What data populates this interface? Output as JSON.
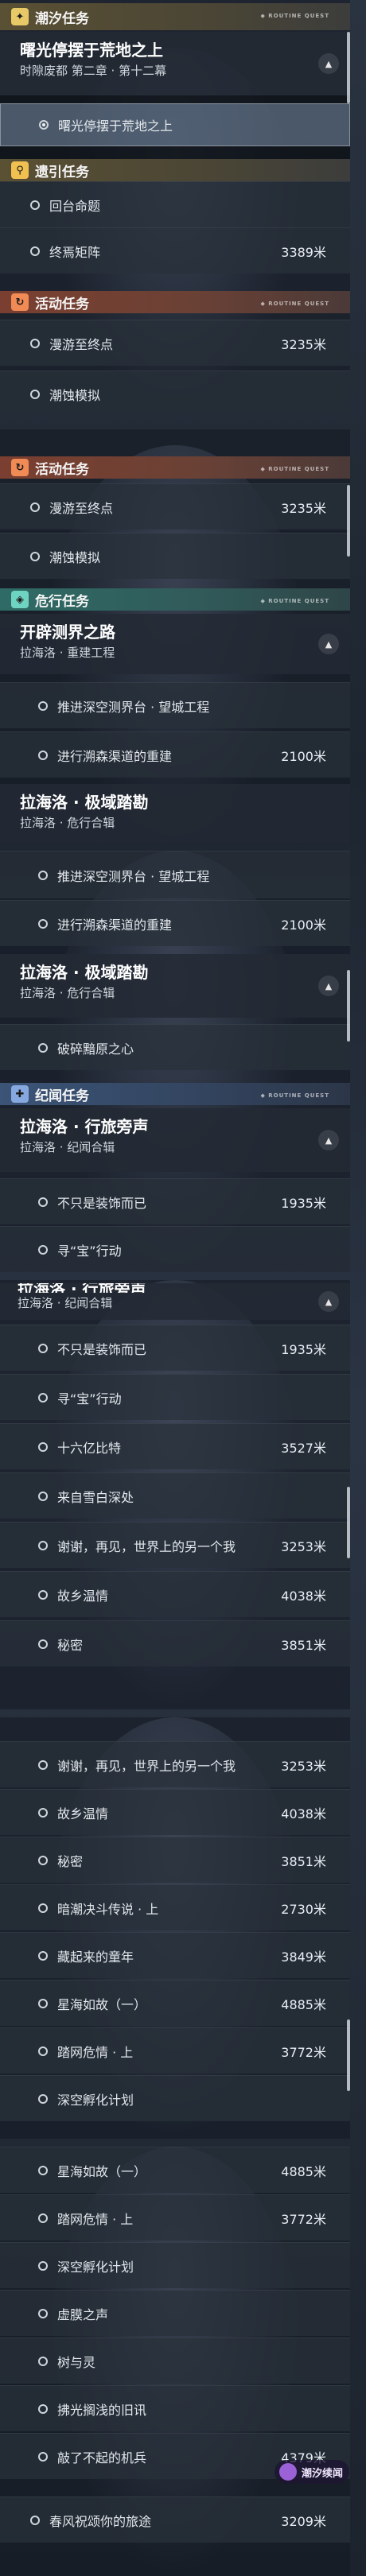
{
  "screen1": {
    "cat_chaoxi": {
      "label": "潮汐任务",
      "icon": "star-icon"
    },
    "main_quest": {
      "name": "曙光停摆于荒地之上",
      "sub": "时隙废都 第二章 · 第十二幕",
      "task": "曙光停摆于荒地之上"
    },
    "cat_guide": {
      "label": "遗引任务",
      "icon": "pin-icon"
    },
    "guide_tasks": [
      {
        "label": "回台命题",
        "dist": ""
      },
      {
        "label": "终焉矩阵",
        "dist": "3389米"
      }
    ],
    "cat_activity": {
      "label": "活动任务",
      "icon": "refresh-icon"
    },
    "activity_tasks": [
      {
        "label": "漫游至终点",
        "dist": "3235米"
      },
      {
        "label": "潮蚀模拟",
        "dist": ""
      }
    ]
  },
  "screen2": {
    "cat_activity": {
      "label": "活动任务"
    },
    "activity_tasks": [
      {
        "label": "漫游至终点",
        "dist": "3235米"
      },
      {
        "label": "潮蚀模拟",
        "dist": ""
      }
    ],
    "cat_danger": {
      "label": "危行任务",
      "icon": "diamond-icon"
    },
    "quest1": {
      "name": "开辟测界之路",
      "sub": "拉海洛 · 重建工程"
    },
    "quest1_tasks": [
      {
        "label": "推进深空测界台 · 望城工程",
        "dist": ""
      },
      {
        "label": "进行溯森渠道的重建",
        "dist": "2100米"
      }
    ],
    "quest2": {
      "name": "拉海洛 · 极域踏勘",
      "sub": "拉海洛 · 危行合辑"
    }
  },
  "screen3": {
    "tasks": [
      {
        "label": "推进深空测界台 · 望城工程",
        "dist": ""
      },
      {
        "label": "进行溯森渠道的重建",
        "dist": "2100米"
      }
    ],
    "quest2": {
      "name": "拉海洛 · 极域踏勘",
      "sub": "拉海洛 · 危行合辑"
    },
    "quest2_task": {
      "label": "破碎黯原之心",
      "dist": ""
    },
    "cat_chronicle": {
      "label": "纪闻任务",
      "icon": "plus-icon"
    },
    "quest3": {
      "name": "拉海洛 · 行旅旁声",
      "sub": "拉海洛 · 纪闻合辑"
    },
    "quest3_tasks": [
      {
        "label": "不只是装饰而已",
        "dist": "1935米"
      },
      {
        "label": "寻“宝”行动",
        "dist": ""
      }
    ]
  },
  "screen4": {
    "partial_title": "拉海洛 · 行旅旁声",
    "sub": "拉海洛 · 纪闻合辑",
    "tasks": [
      {
        "label": "不只是装饰而已",
        "dist": "1935米"
      },
      {
        "label": "寻“宝”行动",
        "dist": ""
      },
      {
        "label": "十六亿比特",
        "dist": "3527米"
      },
      {
        "label": "来自雪白深处",
        "dist": ""
      },
      {
        "label": "谢谢，再见，世界上的另一个我",
        "dist": "3253米"
      },
      {
        "label": "故乡温情",
        "dist": "4038米"
      },
      {
        "label": "秘密",
        "dist": "3851米"
      }
    ]
  },
  "screen5": {
    "tasks": [
      {
        "label": "谢谢，再见，世界上的另一个我",
        "dist": "3253米"
      },
      {
        "label": "故乡温情",
        "dist": "4038米"
      },
      {
        "label": "秘密",
        "dist": "3851米"
      },
      {
        "label": "暗潮决斗传说 · 上",
        "dist": "2730米"
      },
      {
        "label": "藏起来的童年",
        "dist": "3849米"
      },
      {
        "label": "星海如故（一）",
        "dist": "4885米"
      },
      {
        "label": "踏网危情 · 上",
        "dist": "3772米"
      },
      {
        "label": "深空孵化计划",
        "dist": ""
      }
    ]
  },
  "screen6": {
    "tasks": [
      {
        "label": "星海如故（一）",
        "dist": "4885米"
      },
      {
        "label": "踏网危情 · 上",
        "dist": "3772米"
      },
      {
        "label": "深空孵化计划",
        "dist": ""
      },
      {
        "label": "虚膜之声",
        "dist": ""
      },
      {
        "label": "树与灵",
        "dist": ""
      },
      {
        "label": "拂光搁浅的旧讯",
        "dist": ""
      },
      {
        "label": "敲了不起的机兵",
        "dist": "4379米"
      },
      {
        "label": "春风祝颂你的旅途",
        "dist": "3209米"
      }
    ],
    "logo_text": "潮汐续闻"
  },
  "header_meta": "ROUTINE QUEST"
}
